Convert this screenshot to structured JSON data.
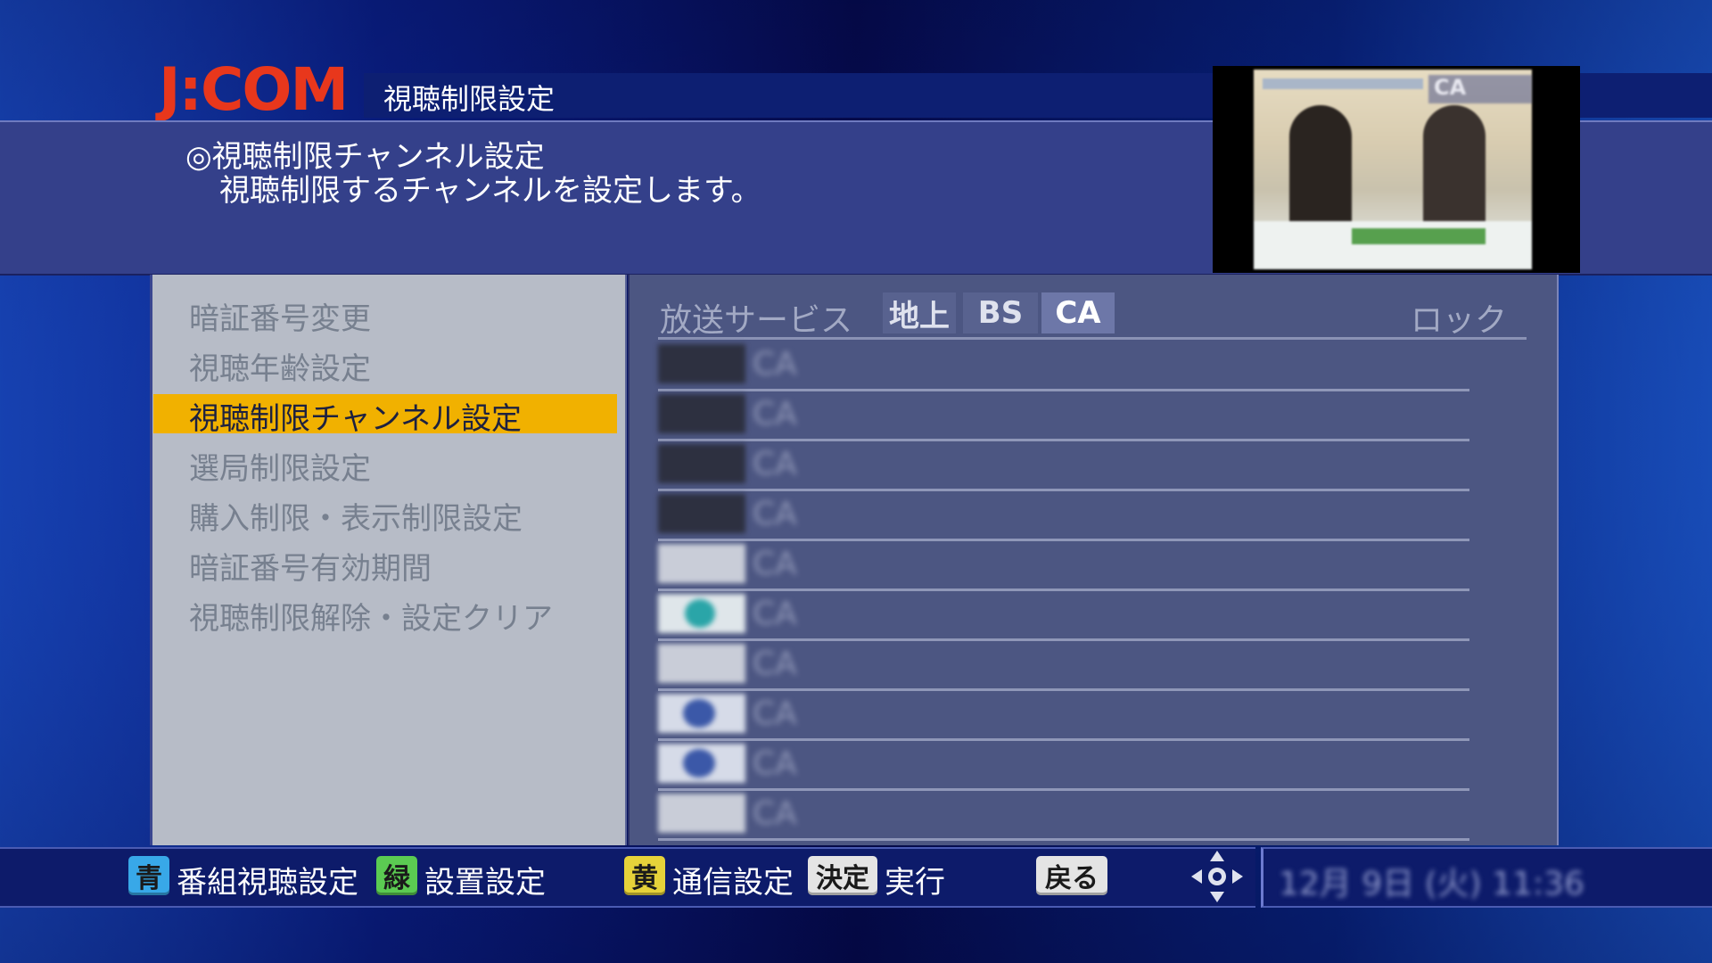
{
  "header": {
    "logo": "J:COM",
    "title": "視聴制限設定",
    "desc_line1": "◎視聴制限チャンネル設定",
    "desc_line2": "視聴制限するチャンネルを設定します。"
  },
  "preview": {
    "channel_overlay": "CA"
  },
  "menu": {
    "items": [
      {
        "label": "暗証番号変更",
        "selected": false
      },
      {
        "label": "視聴年齢設定",
        "selected": false
      },
      {
        "label": "視聴制限チャンネル設定",
        "selected": true
      },
      {
        "label": "選局制限設定",
        "selected": false
      },
      {
        "label": "購入制限・表示制限設定",
        "selected": false
      },
      {
        "label": "暗証番号有効期間",
        "selected": false
      },
      {
        "label": "視聴制限解除・設定クリア",
        "selected": false
      }
    ]
  },
  "channel_list": {
    "header": "放送サービス",
    "tabs": [
      "地上",
      "BS",
      "CA"
    ],
    "active_tab": "CA",
    "lock_header": "ロック",
    "rows": [
      {
        "service": "CA"
      },
      {
        "service": "CA"
      },
      {
        "service": "CA"
      },
      {
        "service": "CA"
      },
      {
        "service": "CA"
      },
      {
        "service": "CA"
      },
      {
        "service": "CA"
      },
      {
        "service": "CA"
      },
      {
        "service": "CA"
      },
      {
        "service": "CA"
      }
    ]
  },
  "bottom_bar": {
    "blue_key": "青",
    "blue_label": "番組視聴設定",
    "green_key": "緑",
    "green_label": "設置設定",
    "yellow_key": "黄",
    "yellow_label": "通信設定",
    "decide_key": "決定",
    "decide_label": "実行",
    "back_key": "戻る"
  },
  "colors": {
    "logo": "#e8371c",
    "selection": "#f1b100",
    "blue_key": "#38a8e8",
    "green_key": "#5bcb52",
    "yellow_key": "#e6d23a"
  }
}
